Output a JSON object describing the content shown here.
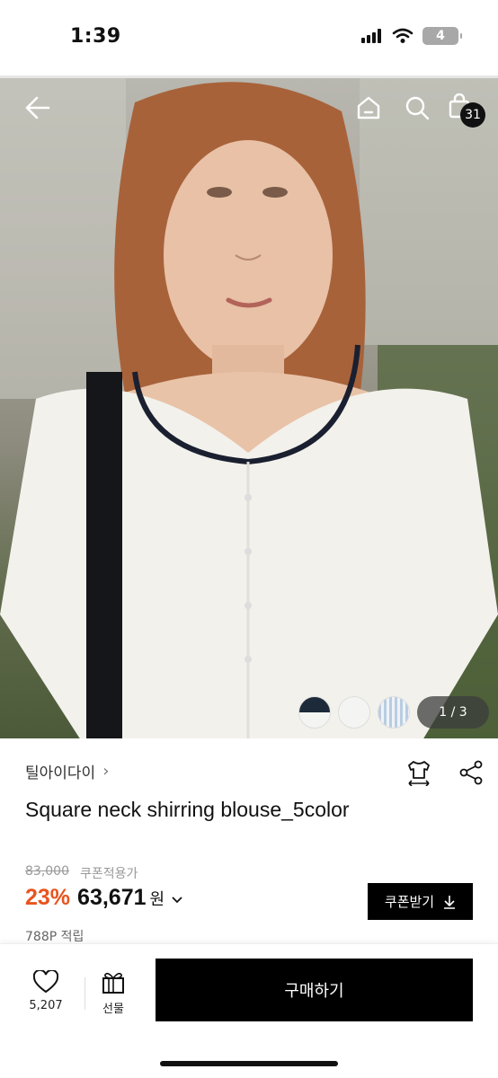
{
  "status_bar": {
    "time": "1:39",
    "battery": "4"
  },
  "header": {
    "cart_count": "31"
  },
  "gallery": {
    "pager": "1 / 3",
    "swatch_colors": [
      "#1c2a3a",
      "#f4f4f2",
      "#b9cde0"
    ]
  },
  "product": {
    "brand": "틸아이다이",
    "title": "Square neck shirring blouse_5color",
    "original_price": "83,000",
    "coupon_applied_label": "쿠폰적용가",
    "discount": "23%",
    "price": "63,671",
    "currency": "원",
    "points": "788P 적립"
  },
  "coupon_button": {
    "label": "쿠폰받기"
  },
  "bottom_bar": {
    "like_count": "5,207",
    "gift_label": "선물",
    "buy_label": "구매하기"
  },
  "colors": {
    "discount": "#e8541e",
    "primary": "#000000"
  }
}
